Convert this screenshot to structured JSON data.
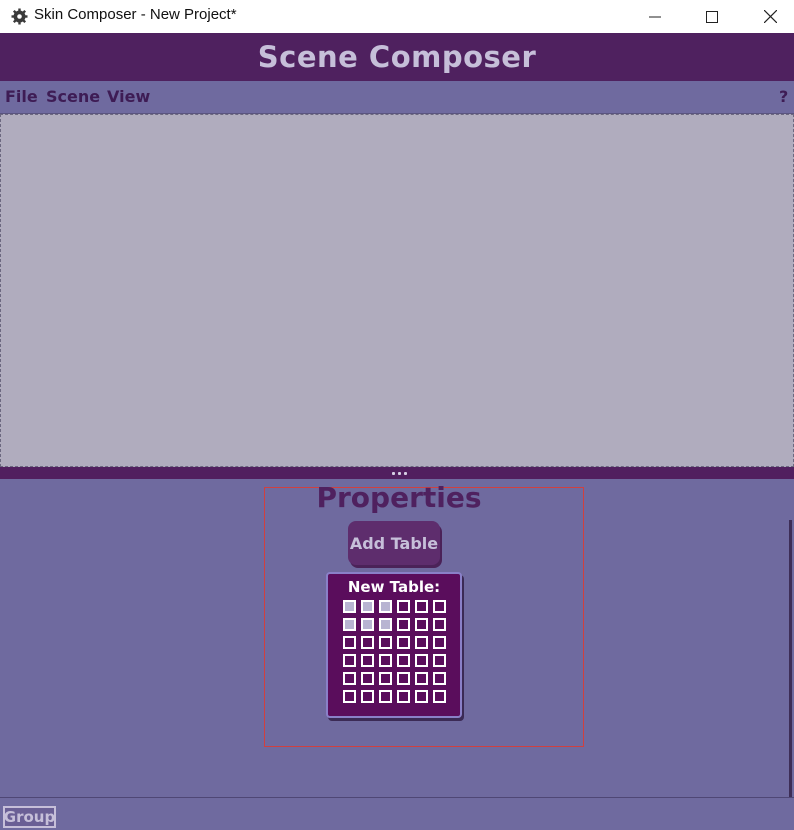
{
  "window": {
    "title": "Skin Composer - New Project*",
    "controls": {
      "minimize": "minimize-icon",
      "maximize": "maximize-icon",
      "close": "close-icon"
    }
  },
  "header": {
    "title": "Scene Composer"
  },
  "menu": {
    "file": "File",
    "scene": "Scene",
    "view": "View",
    "help": "?"
  },
  "properties": {
    "title": "Properties",
    "add_table_label": "Add Table",
    "new_table": {
      "label": "New Table:",
      "columns": 6,
      "rows": 6,
      "selected_columns": 3,
      "selected_rows": 2
    }
  },
  "footer": {
    "group_label": "Group"
  },
  "colors": {
    "header_bg": "#4f215f",
    "panel_bg": "#6f6a9f",
    "preview_bg": "#b0acbe",
    "accent_text": "#c6bfd9",
    "popup_bg": "#5a0d5c"
  }
}
